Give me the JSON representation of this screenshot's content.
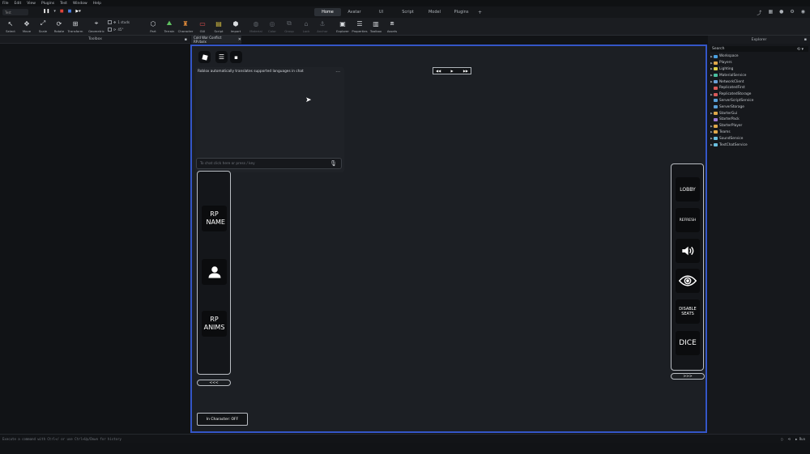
{
  "menu": [
    "File",
    "Edit",
    "View",
    "Plugins",
    "Test",
    "Window",
    "Help"
  ],
  "mode_select": "Test",
  "tabs": [
    {
      "label": "Home",
      "active": true
    },
    {
      "label": "Avatar",
      "active": false
    },
    {
      "label": "UI",
      "active": false
    },
    {
      "label": "Script",
      "active": false
    },
    {
      "label": "Model",
      "active": false
    },
    {
      "label": "Plugins",
      "active": false
    }
  ],
  "tools": [
    "Select",
    "Move",
    "Scale",
    "Rotate",
    "Transform",
    "Geometric",
    "Part",
    "Terrain",
    "Character",
    "GUI",
    "Script",
    "Import",
    "Material",
    "Color",
    "Group",
    "Lock",
    "Anchor",
    "Explorer",
    "Properties",
    "Toolbox",
    "Assets"
  ],
  "stud_move": "1 studs",
  "stud_rotate": "45°",
  "panels": {
    "toolbox_title": "Toolbox",
    "doc_tab": "Cold War Conflict RP.rbxlx",
    "explorer_title": "Explorer",
    "explorer_search": "Search"
  },
  "explorer_items": [
    {
      "label": "Workspace",
      "arrow": true,
      "color": "#4a9fe0"
    },
    {
      "label": "Players",
      "arrow": true,
      "color": "#e0a84a"
    },
    {
      "label": "Lighting",
      "arrow": true,
      "color": "#e0d24a"
    },
    {
      "label": "MaterialService",
      "arrow": true,
      "color": "#4ac0a0"
    },
    {
      "label": "NetworkClient",
      "arrow": true,
      "color": "#6aa0d8"
    },
    {
      "label": "ReplicatedFirst",
      "arrow": false,
      "color": "#d85a5a"
    },
    {
      "label": "ReplicatedStorage",
      "arrow": true,
      "color": "#d85a5a"
    },
    {
      "label": "ServerScriptService",
      "arrow": false,
      "color": "#5aa0d8"
    },
    {
      "label": "ServerStorage",
      "arrow": false,
      "color": "#5aa0d8"
    },
    {
      "label": "StarterGui",
      "arrow": true,
      "color": "#e0a84a"
    },
    {
      "label": "StarterPack",
      "arrow": false,
      "color": "#a07ad8"
    },
    {
      "label": "StarterPlayer",
      "arrow": true,
      "color": "#e0a84a"
    },
    {
      "label": "Teams",
      "arrow": true,
      "color": "#e0a84a"
    },
    {
      "label": "SoundService",
      "arrow": true,
      "color": "#6ac0e0"
    },
    {
      "label": "TextChatService",
      "arrow": true,
      "color": "#6ac0e0"
    }
  ],
  "game": {
    "chat_message": "Roblox automatically translates supported languages in chat",
    "chat_placeholder": "To chat click here or press / key",
    "left_buttons": {
      "rp_name": "RP NAME",
      "rp_anims": "RP ANIMS"
    },
    "left_nav": "<<<",
    "right_nav": ">>>",
    "in_character": "In Character: OFF",
    "right_buttons": {
      "lobby": "LOBBY",
      "refresh": "REFRESH",
      "disable_seats": "DISABLE SEATS",
      "dice": "DICE"
    }
  },
  "command_placeholder": "Execute a command with Ctrl+/ or use Ctrl+Up/Down for history",
  "command_run": "Run"
}
